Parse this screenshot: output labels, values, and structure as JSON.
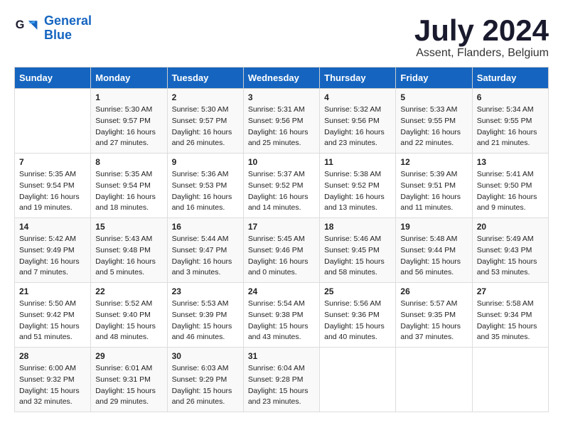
{
  "logo": {
    "line1": "General",
    "line2": "Blue"
  },
  "title": "July 2024",
  "subtitle": "Assent, Flanders, Belgium",
  "days_of_week": [
    "Sunday",
    "Monday",
    "Tuesday",
    "Wednesday",
    "Thursday",
    "Friday",
    "Saturday"
  ],
  "weeks": [
    [
      {
        "day": "",
        "content": ""
      },
      {
        "day": "1",
        "content": "Sunrise: 5:30 AM\nSunset: 9:57 PM\nDaylight: 16 hours\nand 27 minutes."
      },
      {
        "day": "2",
        "content": "Sunrise: 5:30 AM\nSunset: 9:57 PM\nDaylight: 16 hours\nand 26 minutes."
      },
      {
        "day": "3",
        "content": "Sunrise: 5:31 AM\nSunset: 9:56 PM\nDaylight: 16 hours\nand 25 minutes."
      },
      {
        "day": "4",
        "content": "Sunrise: 5:32 AM\nSunset: 9:56 PM\nDaylight: 16 hours\nand 23 minutes."
      },
      {
        "day": "5",
        "content": "Sunrise: 5:33 AM\nSunset: 9:55 PM\nDaylight: 16 hours\nand 22 minutes."
      },
      {
        "day": "6",
        "content": "Sunrise: 5:34 AM\nSunset: 9:55 PM\nDaylight: 16 hours\nand 21 minutes."
      }
    ],
    [
      {
        "day": "7",
        "content": "Sunrise: 5:35 AM\nSunset: 9:54 PM\nDaylight: 16 hours\nand 19 minutes."
      },
      {
        "day": "8",
        "content": "Sunrise: 5:35 AM\nSunset: 9:54 PM\nDaylight: 16 hours\nand 18 minutes."
      },
      {
        "day": "9",
        "content": "Sunrise: 5:36 AM\nSunset: 9:53 PM\nDaylight: 16 hours\nand 16 minutes."
      },
      {
        "day": "10",
        "content": "Sunrise: 5:37 AM\nSunset: 9:52 PM\nDaylight: 16 hours\nand 14 minutes."
      },
      {
        "day": "11",
        "content": "Sunrise: 5:38 AM\nSunset: 9:52 PM\nDaylight: 16 hours\nand 13 minutes."
      },
      {
        "day": "12",
        "content": "Sunrise: 5:39 AM\nSunset: 9:51 PM\nDaylight: 16 hours\nand 11 minutes."
      },
      {
        "day": "13",
        "content": "Sunrise: 5:41 AM\nSunset: 9:50 PM\nDaylight: 16 hours\nand 9 minutes."
      }
    ],
    [
      {
        "day": "14",
        "content": "Sunrise: 5:42 AM\nSunset: 9:49 PM\nDaylight: 16 hours\nand 7 minutes."
      },
      {
        "day": "15",
        "content": "Sunrise: 5:43 AM\nSunset: 9:48 PM\nDaylight: 16 hours\nand 5 minutes."
      },
      {
        "day": "16",
        "content": "Sunrise: 5:44 AM\nSunset: 9:47 PM\nDaylight: 16 hours\nand 3 minutes."
      },
      {
        "day": "17",
        "content": "Sunrise: 5:45 AM\nSunset: 9:46 PM\nDaylight: 16 hours\nand 0 minutes."
      },
      {
        "day": "18",
        "content": "Sunrise: 5:46 AM\nSunset: 9:45 PM\nDaylight: 15 hours\nand 58 minutes."
      },
      {
        "day": "19",
        "content": "Sunrise: 5:48 AM\nSunset: 9:44 PM\nDaylight: 15 hours\nand 56 minutes."
      },
      {
        "day": "20",
        "content": "Sunrise: 5:49 AM\nSunset: 9:43 PM\nDaylight: 15 hours\nand 53 minutes."
      }
    ],
    [
      {
        "day": "21",
        "content": "Sunrise: 5:50 AM\nSunset: 9:42 PM\nDaylight: 15 hours\nand 51 minutes."
      },
      {
        "day": "22",
        "content": "Sunrise: 5:52 AM\nSunset: 9:40 PM\nDaylight: 15 hours\nand 48 minutes."
      },
      {
        "day": "23",
        "content": "Sunrise: 5:53 AM\nSunset: 9:39 PM\nDaylight: 15 hours\nand 46 minutes."
      },
      {
        "day": "24",
        "content": "Sunrise: 5:54 AM\nSunset: 9:38 PM\nDaylight: 15 hours\nand 43 minutes."
      },
      {
        "day": "25",
        "content": "Sunrise: 5:56 AM\nSunset: 9:36 PM\nDaylight: 15 hours\nand 40 minutes."
      },
      {
        "day": "26",
        "content": "Sunrise: 5:57 AM\nSunset: 9:35 PM\nDaylight: 15 hours\nand 37 minutes."
      },
      {
        "day": "27",
        "content": "Sunrise: 5:58 AM\nSunset: 9:34 PM\nDaylight: 15 hours\nand 35 minutes."
      }
    ],
    [
      {
        "day": "28",
        "content": "Sunrise: 6:00 AM\nSunset: 9:32 PM\nDaylight: 15 hours\nand 32 minutes."
      },
      {
        "day": "29",
        "content": "Sunrise: 6:01 AM\nSunset: 9:31 PM\nDaylight: 15 hours\nand 29 minutes."
      },
      {
        "day": "30",
        "content": "Sunrise: 6:03 AM\nSunset: 9:29 PM\nDaylight: 15 hours\nand 26 minutes."
      },
      {
        "day": "31",
        "content": "Sunrise: 6:04 AM\nSunset: 9:28 PM\nDaylight: 15 hours\nand 23 minutes."
      },
      {
        "day": "",
        "content": ""
      },
      {
        "day": "",
        "content": ""
      },
      {
        "day": "",
        "content": ""
      }
    ]
  ]
}
